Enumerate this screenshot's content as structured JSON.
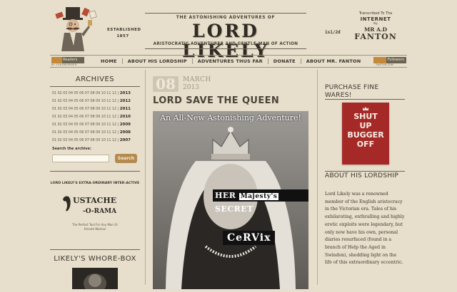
{
  "header": {
    "top_line": "THE ASTONISHING ADVENTURES OF",
    "logo": "LORD LIKELY",
    "tagline": "ARISTOCRATIC ADVENTURER AND GENTLE-MAN OF ACTION",
    "established_label": "ESTABLISHED",
    "established_year": "1857",
    "issue": "1s1/2d",
    "transcribed": {
      "line1": "Transcribed To The",
      "line2": "INTERNET",
      "line3": "by",
      "line4": "MR A.D",
      "line5": "FANTON"
    }
  },
  "counters": {
    "readers_label": "Readers",
    "readers_sub": "BY FEEDBURNER",
    "followers_label": "Followers",
    "followers_sub": "TWITTER.COM"
  },
  "nav": {
    "items": [
      {
        "label": "HOME"
      },
      {
        "label": "ABOUT HIS LORDSHIP"
      },
      {
        "label": "ADVENTURES THUS FAR"
      },
      {
        "label": "DONATE"
      },
      {
        "label": "ABOUT MR. FANTON"
      }
    ]
  },
  "archives": {
    "title": "ARCHIVES",
    "months": "01 02 03 04 05 06 07 08 09 10 11 12 |",
    "years": [
      "2013",
      "2012",
      "2011",
      "2010",
      "2009",
      "2008",
      "2007"
    ],
    "search_label": "Search the archive:",
    "search_placeholder": "",
    "search_button": "Search"
  },
  "moustache": {
    "top": "LORD LIKELY'S EXTRA-ORDINARY INTER-ACTIVE",
    "logo": "MOUSTACHE-O-RAMA",
    "sub1": "The Perfect Tool For Any Man Or",
    "sub2": "Hirsute Woman"
  },
  "whorebox": {
    "title": "LIKELY'S WHORE-BOX"
  },
  "post": {
    "day": "08",
    "month": "MARCH",
    "year": "2013",
    "title": "LORD SAVE THE QUEEN",
    "image_caption": "An All-New Astonishing Adventure!",
    "cut1_a": "HER",
    "cut1_b": "Majesty's",
    "cut1_c": "SECRET",
    "cut2": "CeRVix"
  },
  "wares": {
    "title": "PURCHASE FINE WARES!",
    "shirt_line1": "SHUT",
    "shirt_line2": "UP",
    "shirt_line3": "BUGGER",
    "shirt_line4": "OFF"
  },
  "about": {
    "title": "ABOUT HIS LORDSHIP",
    "body": "Lord Likely was a renowned member of the English aristocracy in the Victorian era. Tales of his exhilarating, enthralling and highly erotic exploits were legendary, but only now have his own, personal diaries resurfaced (found in a branch of Help the Aged in Swindon), shedding light on the life of this extraordinary eccentric."
  }
}
